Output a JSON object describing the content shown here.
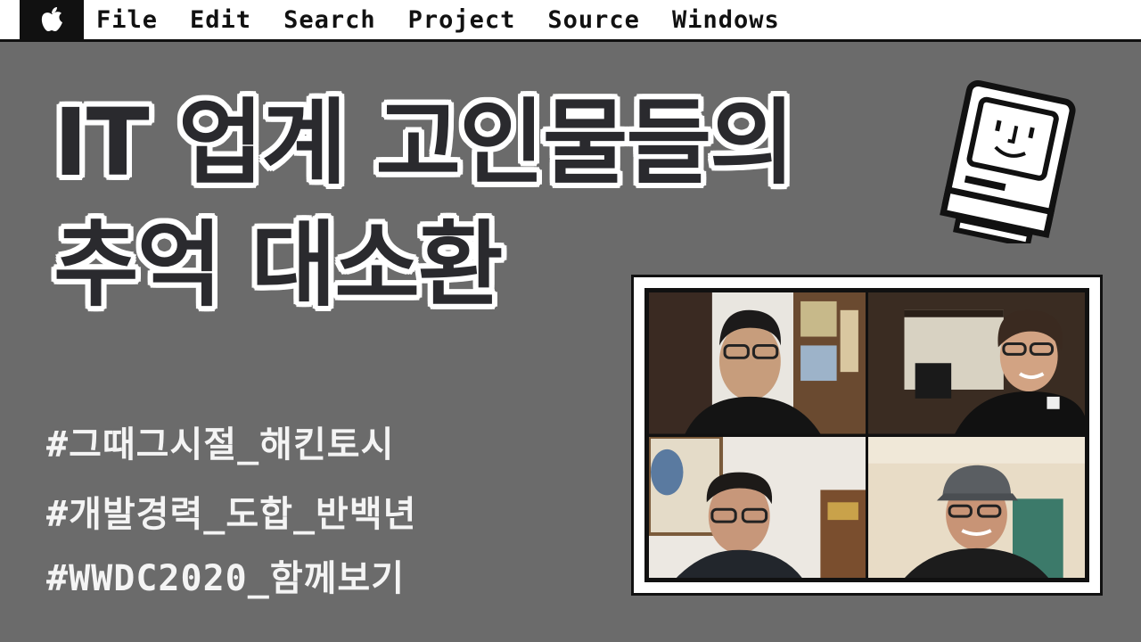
{
  "menubar": {
    "apple_icon": "apple-logo-icon",
    "items": [
      "File",
      "Edit",
      "Search",
      "Project",
      "Source",
      "Windows"
    ]
  },
  "headline": {
    "line1": "IT 업계 고인물들의",
    "line2": "추억 대소환"
  },
  "hashtags": [
    "#그때그시절_해킨토시",
    "#개발경력_도합_반백년",
    "#WWDC2020_함께보기"
  ],
  "video_call": {
    "participants": 4
  },
  "colors": {
    "background": "#6b6b6b",
    "title_text": "#2a2a2e",
    "title_outline": "#ffffff",
    "menubar": "#ffffff"
  },
  "icons": {
    "mascot": "classic-mac-computer-icon"
  }
}
